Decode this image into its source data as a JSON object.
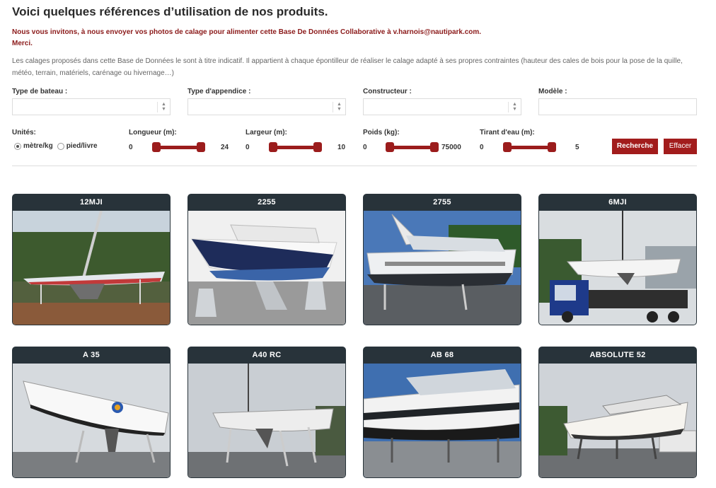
{
  "header": {
    "title": "Voici quelques références d’utilisation de nos produits.",
    "invite_line1": "Nous vous invitons, à nous envoyer vos photos de calage pour alimenter cette Base De Données Collaborative à v.harnois@nautipark.com.",
    "invite_line2": "Merci.",
    "disclaimer": "Les calages proposés dans cette Base de Données le sont à titre indicatif. Il appartient à chaque épontilleur de réaliser le calage adapté à ses propres contraintes (hauteur des cales de bois pour la pose de la quille, météo, terrain, matériels, carénage ou hivernage…)"
  },
  "filters": {
    "boat_type_label": "Type de bateau :",
    "appendage_type_label": "Type d'appendice :",
    "builder_label": "Constructeur :",
    "model_label": "Modèle :"
  },
  "units": {
    "label": "Unités:",
    "metric": "mètre/kg",
    "imperial": "pied/livre",
    "selected": "metric"
  },
  "sliders": [
    {
      "label": "Longueur (m):",
      "min": "0",
      "max": "24"
    },
    {
      "label": "Largeur (m):",
      "min": "0",
      "max": "10"
    },
    {
      "label": "Poids (kg):",
      "min": "0",
      "max": "75000"
    },
    {
      "label": "Tirant d'eau (m):",
      "min": "0",
      "max": "5"
    }
  ],
  "buttons": {
    "search": "Recherche",
    "clear": "Effacer"
  },
  "colors": {
    "accent": "#a21c1c",
    "invite_text": "#8b1a1a",
    "card_header": "#28333a"
  },
  "boats": [
    {
      "name": "12MJI",
      "scene": "sailboat-on-stands"
    },
    {
      "name": "2255",
      "scene": "motorboat-on-stands"
    },
    {
      "name": "2755",
      "scene": "motorboat-on-stands"
    },
    {
      "name": "6MJI",
      "scene": "sailboat-on-truck"
    },
    {
      "name": "A 35",
      "scene": "sailboat-on-stands"
    },
    {
      "name": "A40 RC",
      "scene": "sailboat-on-stands"
    },
    {
      "name": "AB 68",
      "scene": "motoryacht-on-stands"
    },
    {
      "name": "ABSOLUTE 52",
      "scene": "motoryacht-on-stands"
    }
  ]
}
